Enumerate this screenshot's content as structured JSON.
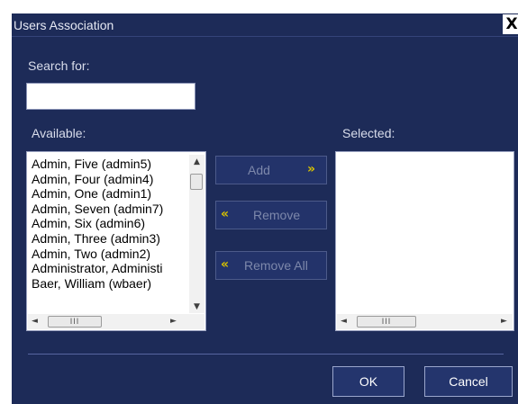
{
  "dialog": {
    "title": "Users Association",
    "close_glyph": "X"
  },
  "search": {
    "label": "Search for:",
    "value": ""
  },
  "available": {
    "label": "Available:",
    "items": [
      "Admin, Five (admin5)",
      "Admin, Four (admin4)",
      "Admin, One (admin1)",
      "Admin, Seven (admin7)",
      "Admin, Six (admin6)",
      "Admin, Three (admin3)",
      "Admin, Two (admin2)",
      "Administrator, Administi",
      "Baer, William (wbaer)"
    ]
  },
  "selected": {
    "label": "Selected:",
    "items": []
  },
  "buttons": {
    "add": "Add",
    "remove": "Remove",
    "remove_all": "Remove All",
    "ok": "OK",
    "cancel": "Cancel",
    "right_chevron": "»",
    "left_chevron": "«"
  },
  "scroll": {
    "up": "▲",
    "down": "▼",
    "left": "◄",
    "right": "►",
    "grip": "III"
  },
  "colors": {
    "dialog_bg": "#1d2b58",
    "button_bg": "#23336a",
    "disabled_text": "#7d88ab",
    "chevron": "#d8c200"
  },
  "icons": [
    "close-icon",
    "chevron-right-icon",
    "chevron-left-icon",
    "scroll-up-icon",
    "scroll-down-icon",
    "scroll-left-icon",
    "scroll-right-icon"
  ]
}
